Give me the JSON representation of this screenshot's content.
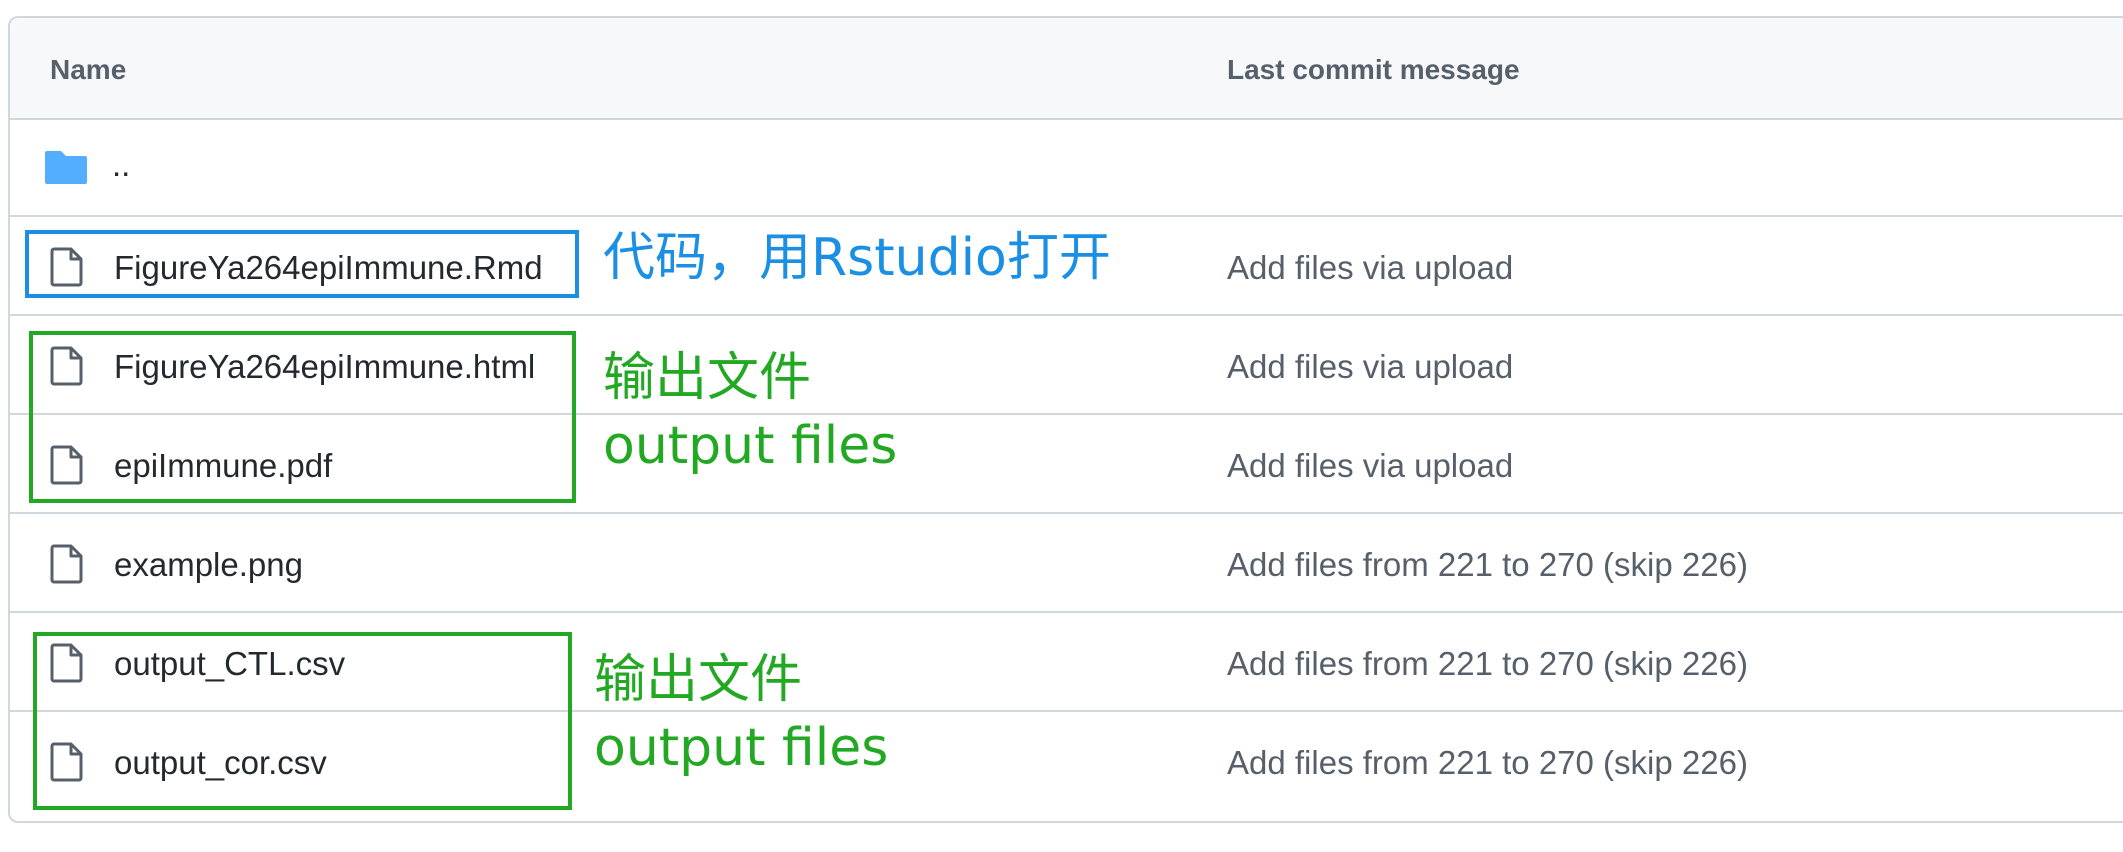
{
  "table": {
    "columns": {
      "name": "Name",
      "message": "Last commit message"
    },
    "parent_dir": {
      "label": ".."
    },
    "rows": [
      {
        "name": "FigureYa264epiImmune.Rmd",
        "message": "Add files via upload",
        "icon": "file-icon"
      },
      {
        "name": "FigureYa264epiImmune.html",
        "message": "Add files via upload",
        "icon": "file-icon"
      },
      {
        "name": "epiImmune.pdf",
        "message": "Add files via upload",
        "icon": "file-icon"
      },
      {
        "name": "example.png",
        "message": "Add files from 221 to 270 (skip 226)",
        "icon": "file-icon"
      },
      {
        "name": "output_CTL.csv",
        "message": "Add files from 221 to 270 (skip 226)",
        "icon": "file-icon"
      },
      {
        "name": "output_cor.csv",
        "message": "Add files from 221 to 270 (skip 226)",
        "icon": "file-icon"
      }
    ]
  },
  "annotations": {
    "code_note": "代码，用Rstudio打开",
    "output_note_1_cn": "输出文件",
    "output_note_1_en": "output files",
    "output_note_2_cn": "输出文件",
    "output_note_2_en": "output files"
  },
  "colors": {
    "folder": "#54aeff",
    "annotation_blue": "#1a8fe3",
    "annotation_green": "#22a822",
    "border": "#d0d7de",
    "header_bg": "#f6f8fa"
  }
}
